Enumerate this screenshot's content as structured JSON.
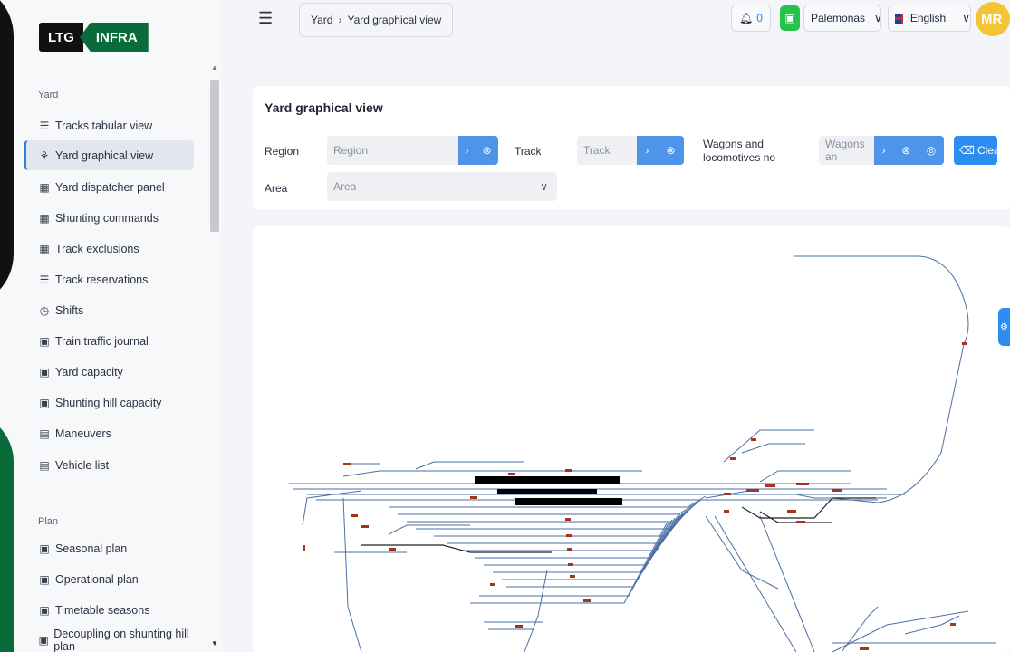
{
  "brand": {
    "logo_left": "LTG",
    "logo_right": "INFRA"
  },
  "sidebar": {
    "sections": [
      {
        "label": "Yard",
        "items": [
          {
            "icon": "list-icon",
            "glyph": "☰",
            "label": "Tracks tabular view"
          },
          {
            "icon": "sitemap-icon",
            "glyph": "⚘",
            "label": "Yard graphical view",
            "active": true
          },
          {
            "icon": "grid-icon",
            "glyph": "▦",
            "label": "Yard dispatcher panel"
          },
          {
            "icon": "grid-icon",
            "glyph": "▦",
            "label": "Shunting commands"
          },
          {
            "icon": "grid-icon",
            "glyph": "▦",
            "label": "Track exclusions"
          },
          {
            "icon": "list-icon",
            "glyph": "☰",
            "label": "Track reservations"
          },
          {
            "icon": "timer-icon",
            "glyph": "◷",
            "label": "Shifts"
          },
          {
            "icon": "calendar-icon",
            "glyph": "▣",
            "label": "Train traffic journal"
          },
          {
            "icon": "calendar-icon",
            "glyph": "▣",
            "label": "Yard capacity"
          },
          {
            "icon": "calendar-icon",
            "glyph": "▣",
            "label": "Shunting hill capacity"
          },
          {
            "icon": "document-icon",
            "glyph": "▤",
            "label": "Maneuvers"
          },
          {
            "icon": "document-icon",
            "glyph": "▤",
            "label": "Vehicle list"
          }
        ]
      },
      {
        "label": "Plan",
        "items": [
          {
            "icon": "calendar-icon",
            "glyph": "▣",
            "label": "Seasonal plan"
          },
          {
            "icon": "calendar-icon",
            "glyph": "▣",
            "label": "Operational plan"
          },
          {
            "icon": "calendar-icon",
            "glyph": "▣",
            "label": "Timetable seasons"
          },
          {
            "icon": "calendar-icon",
            "glyph": "▣",
            "label": "Decoupling on shunting hill plan"
          }
        ]
      }
    ]
  },
  "header": {
    "breadcrumb": [
      "Yard",
      "Yard graphical view"
    ],
    "notifications_count": "0",
    "station": "Palemonas",
    "language": "English",
    "avatar_initials": "MR"
  },
  "filters": {
    "title": "Yard graphical view",
    "region_label": "Region",
    "region_placeholder": "Region",
    "track_label": "Track",
    "track_placeholder": "Track",
    "wagons_label": "Wagons and locomotives no",
    "wagons_placeholder": "Wagons an",
    "area_label": "Area",
    "area_placeholder": "Area",
    "clear_label": "Clear"
  },
  "colors": {
    "accent": "#2d8cf0",
    "brand_green": "#0a6b3a",
    "track": "#4a6fa5",
    "wagon": "#a3341f"
  }
}
